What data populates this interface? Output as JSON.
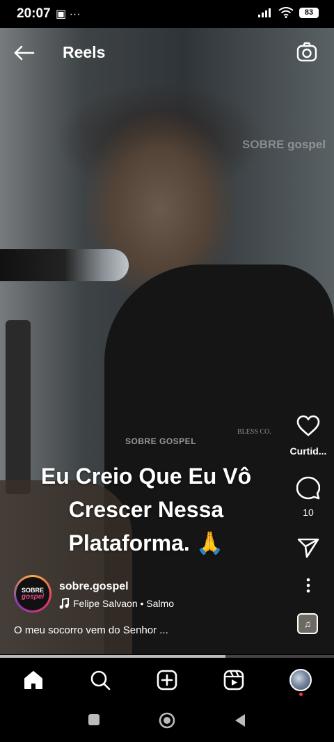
{
  "status_bar": {
    "time": "20:07",
    "notif_icons": "▣ ···",
    "battery": "83"
  },
  "header": {
    "title": "Reels"
  },
  "video": {
    "watermark_top": "SOBRE gospel",
    "watermark_mid": "SOBRE GOSPEL",
    "shirt_text": "BLESS CO.",
    "caption_overlay": "Eu Creio Que Eu Vô Crescer Nessa Plataforma. 🙏"
  },
  "actions": {
    "like_label": "Curtid...",
    "comment_count": "10"
  },
  "post": {
    "username": "sobre.gospel",
    "avatar_line1": "SOBRE",
    "avatar_line2": "gospel",
    "music": "Felipe Salvaon • Salmo",
    "description": "O meu socorro vem do Senhor ..."
  },
  "progress": {
    "fraction": 0.675
  },
  "colors": {
    "background": "#000000",
    "text": "#ffffff"
  }
}
